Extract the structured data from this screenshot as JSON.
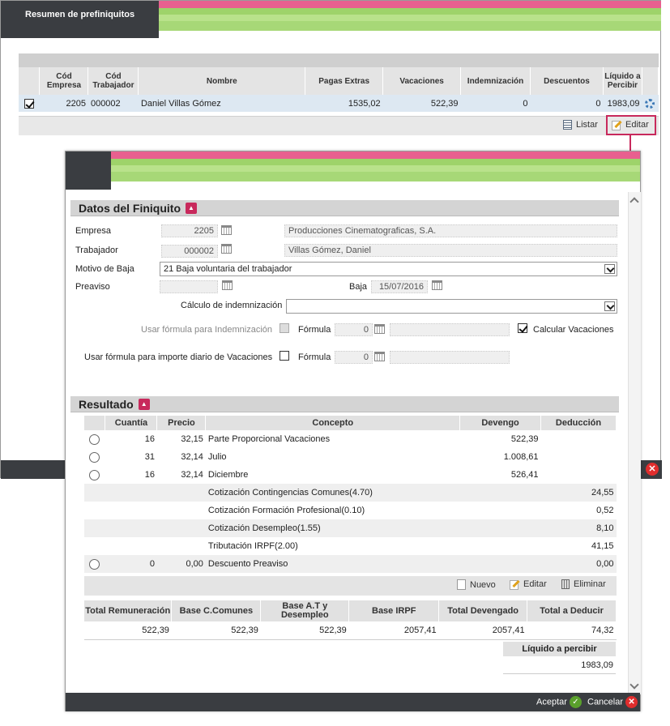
{
  "outer": {
    "title": "Resumen de prefiniquitos",
    "columns": [
      "Cód Empresa",
      "Cód Trabajador",
      "Nombre",
      "Pagas Extras",
      "Vacaciones",
      "Indemnización",
      "Descuentos",
      "Líquido a Percibir"
    ],
    "row": {
      "checked": true,
      "empresa": "2205",
      "trabajador": "000002",
      "nombre": "Daniel Villas Gómez",
      "pagas_extras": "1535,02",
      "vacaciones": "522,39",
      "indemnizacion": "0",
      "descuentos": "0",
      "liquido": "1983,09"
    },
    "toolbar": {
      "listar": "Listar",
      "editar": "Editar"
    },
    "colors": {
      "accent": "#c8295c",
      "pink": "#e8608f",
      "green": "#9ed36a",
      "dark": "#3a3d41"
    }
  },
  "datos": {
    "title": "Datos del Finiquito",
    "empresa_label": "Empresa",
    "empresa_code": "2205",
    "empresa_name": "Producciones Cinematograficas, S.A.",
    "trabajador_label": "Trabajador",
    "trabajador_code": "000002",
    "trabajador_name": "Villas Gómez, Daniel",
    "motivo_label": "Motivo de Baja",
    "motivo_value": "21 Baja voluntaria del trabajador",
    "preaviso_label": "Preaviso",
    "preaviso_value": "",
    "baja_label": "Baja",
    "baja_value": "15/07/2016",
    "calculo_label": "Cálculo de indemnización",
    "calculo_value": "",
    "formula_indem_label": "Usar fórmula para Indemnización",
    "formula_label": "Fórmula",
    "formula_indem_value": "0",
    "calcular_vac_label": "Calcular Vacaciones",
    "calcular_vac_checked": true,
    "formula_vac_label": "Usar fórmula para importe diario de Vacaciones",
    "formula_vac_value": "0"
  },
  "resultado": {
    "title": "Resultado",
    "columns": [
      "Cuantía",
      "Precio",
      "Concepto",
      "Devengo",
      "Deducción"
    ],
    "rows": [
      {
        "radio": true,
        "cuantia": "16",
        "precio": "32,15",
        "concepto": "Parte Proporcional Vacaciones",
        "devengo": "522,39",
        "deduccion": ""
      },
      {
        "radio": true,
        "cuantia": "31",
        "precio": "32,14",
        "concepto": "Julio",
        "devengo": "1.008,61",
        "deduccion": ""
      },
      {
        "radio": true,
        "cuantia": "16",
        "precio": "32,14",
        "concepto": "Diciembre",
        "devengo": "526,41",
        "deduccion": ""
      },
      {
        "radio": false,
        "cuantia": "",
        "precio": "",
        "concepto": "Cotización Contingencias Comunes(4.70)",
        "devengo": "",
        "deduccion": "24,55"
      },
      {
        "radio": false,
        "cuantia": "",
        "precio": "",
        "concepto": "Cotización Formación Profesional(0.10)",
        "devengo": "",
        "deduccion": "0,52"
      },
      {
        "radio": false,
        "cuantia": "",
        "precio": "",
        "concepto": "Cotización Desempleo(1.55)",
        "devengo": "",
        "deduccion": "8,10"
      },
      {
        "radio": false,
        "cuantia": "",
        "precio": "",
        "concepto": "Tributación IRPF(2.00)",
        "devengo": "",
        "deduccion": "41,15"
      },
      {
        "radio": true,
        "cuantia": "0",
        "precio": "0,00",
        "concepto": "Descuento Preaviso",
        "devengo": "",
        "deduccion": "0,00"
      }
    ],
    "toolbar": {
      "nuevo": "Nuevo",
      "editar": "Editar",
      "eliminar": "Eliminar"
    },
    "totals_columns": [
      "Total Remuneración",
      "Base C.Comunes",
      "Base A.T y Desempleo",
      "Base IRPF",
      "Total Devengado",
      "Total a Deducir"
    ],
    "totals_values": [
      "522,39",
      "522,39",
      "522,39",
      "2057,41",
      "2057,41",
      "74,32"
    ],
    "liquido_label": "Líquido a percibir",
    "liquido_value": "1983,09"
  },
  "footer": {
    "aceptar": "Aceptar",
    "cancelar": "Cancelar"
  }
}
